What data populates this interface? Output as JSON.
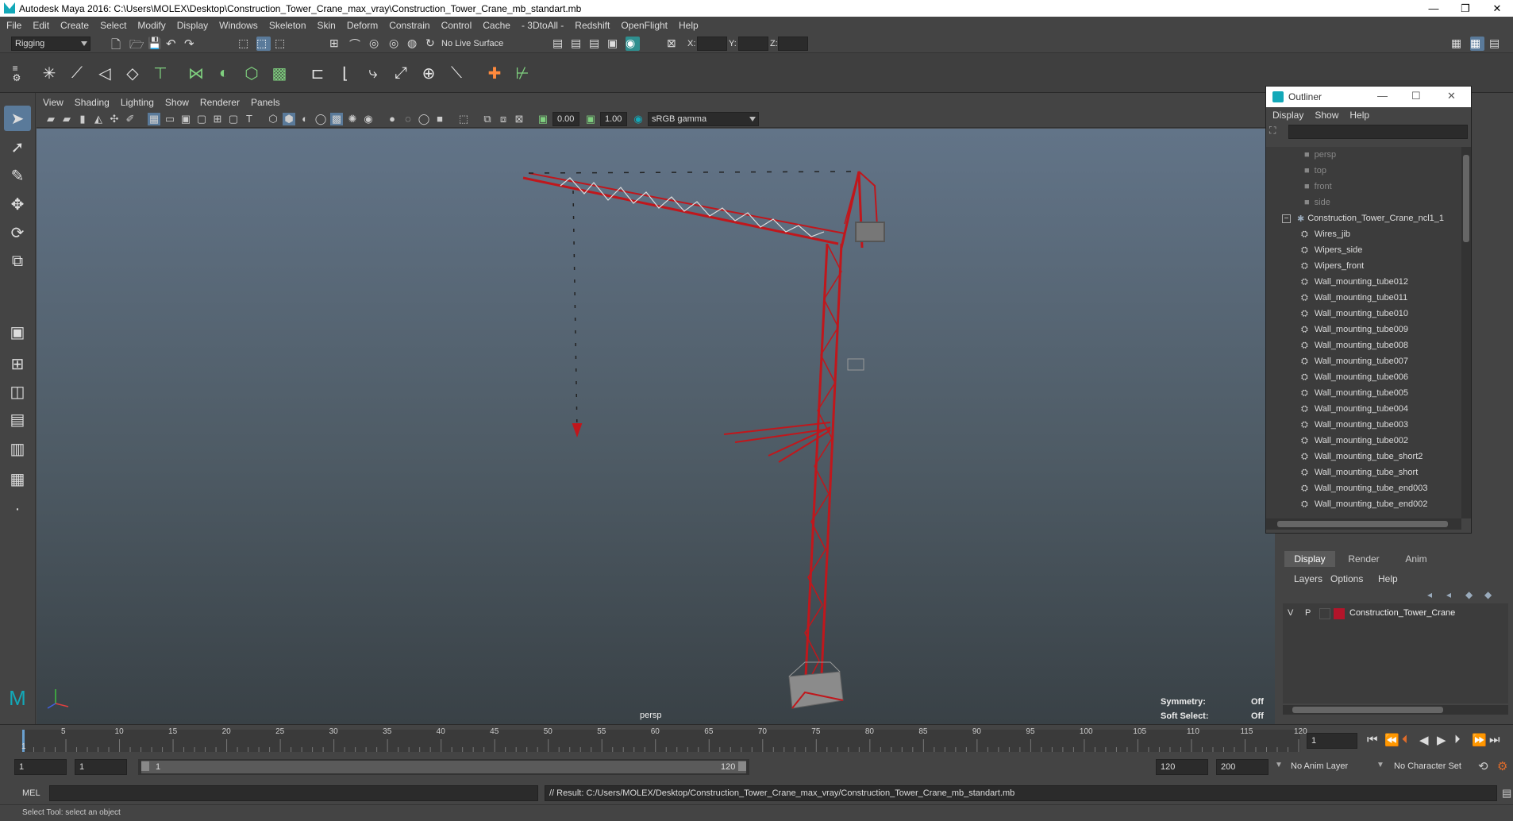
{
  "window": {
    "title": "Autodesk Maya 2016: C:\\Users\\MOLEX\\Desktop\\Construction_Tower_Crane_max_vray\\Construction_Tower_Crane_mb_standart.mb"
  },
  "menubar": [
    "File",
    "Edit",
    "Create",
    "Select",
    "Modify",
    "Display",
    "Windows",
    "Skeleton",
    "Skin",
    "Deform",
    "Constrain",
    "Control",
    "Cache",
    "- 3DtoAll -",
    "Redshift",
    "OpenFlight",
    "Help"
  ],
  "statusline": {
    "mode": "Rigging",
    "live_surface": "No Live Surface",
    "x_label": "X:",
    "y_label": "Y:",
    "z_label": "Z:"
  },
  "panel_menu": [
    "View",
    "Shading",
    "Lighting",
    "Show",
    "Renderer",
    "Panels"
  ],
  "panel_toolbar": {
    "exposure": "0.00",
    "gamma": "1.00",
    "color_space": "sRGB gamma"
  },
  "viewport": {
    "camera_label": "persp",
    "symmetry_label": "Symmetry:",
    "symmetry_value": "Off",
    "soft_select_label": "Soft Select:",
    "soft_select_value": "Off"
  },
  "outliner": {
    "title": "Outliner",
    "menu": [
      "Display",
      "Show",
      "Help"
    ],
    "cameras": [
      "persp",
      "top",
      "front",
      "side"
    ],
    "group": "Construction_Tower_Crane_ncl1_1",
    "children": [
      "Wires_jib",
      "Wipers_side",
      "Wipers_front",
      "Wall_mounting_tube012",
      "Wall_mounting_tube011",
      "Wall_mounting_tube010",
      "Wall_mounting_tube009",
      "Wall_mounting_tube008",
      "Wall_mounting_tube007",
      "Wall_mounting_tube006",
      "Wall_mounting_tube005",
      "Wall_mounting_tube004",
      "Wall_mounting_tube003",
      "Wall_mounting_tube002",
      "Wall_mounting_tube_short2",
      "Wall_mounting_tube_short",
      "Wall_mounting_tube_end003",
      "Wall_mounting_tube_end002"
    ]
  },
  "layer_editor": {
    "tabs": [
      "Display",
      "Render",
      "Anim"
    ],
    "menu": [
      "Layers",
      "Options",
      "Help"
    ],
    "layer": {
      "v": "V",
      "p": "P",
      "name": "Construction_Tower_Crane",
      "color": "#b3152a"
    }
  },
  "timeline": {
    "ticks": [
      "5",
      "10",
      "15",
      "20",
      "25",
      "30",
      "35",
      "40",
      "45",
      "50",
      "55",
      "60",
      "65",
      "70",
      "75",
      "80",
      "85",
      "90",
      "95",
      "100",
      "105",
      "110",
      "115",
      "120"
    ],
    "start_tick": "1",
    "current_frame": "1"
  },
  "range": {
    "start": "1",
    "inner_start": "1",
    "slider_start": "1",
    "slider_end": "120",
    "end": "120",
    "max_end": "200",
    "anim_layer": "No Anim Layer",
    "character_set": "No Character Set"
  },
  "cmdline": {
    "lang": "MEL",
    "result": "// Result: C:/Users/MOLEX/Desktop/Construction_Tower_Crane_max_vray/Construction_Tower_Crane_mb_standart.mb"
  },
  "helpline": {
    "text": "Select Tool: select an object"
  },
  "colors": {
    "crane": "#c0171c",
    "accent": "#13a8b8",
    "bg": "#444444"
  }
}
